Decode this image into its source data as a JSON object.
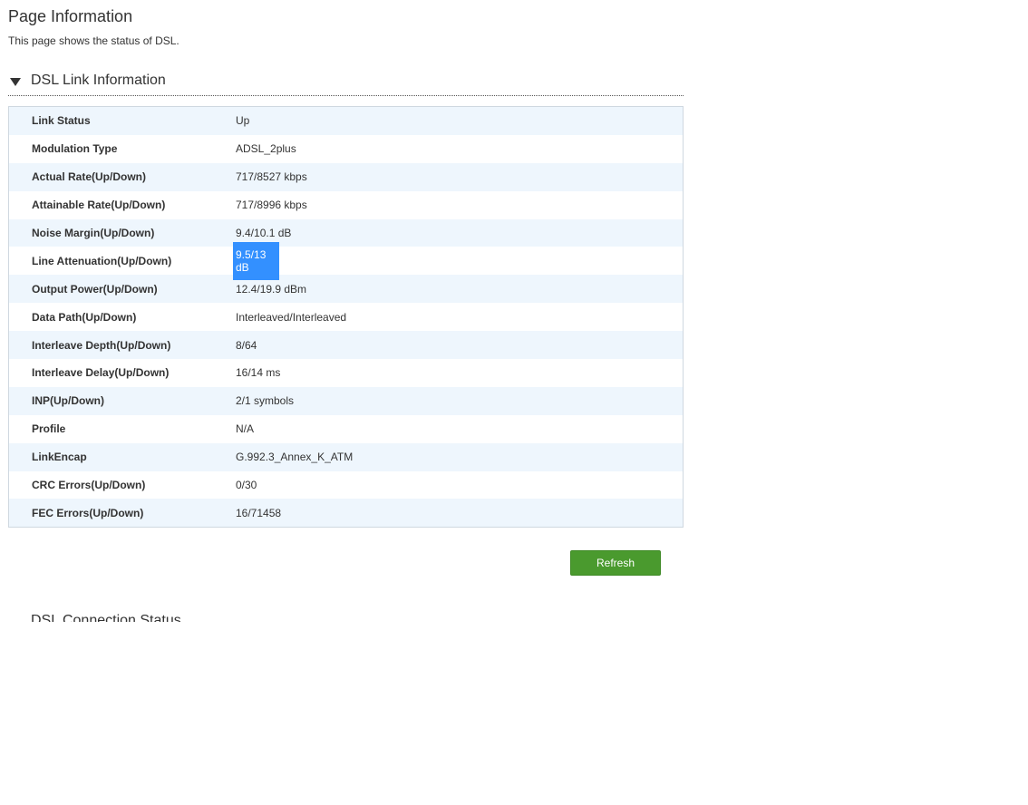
{
  "page": {
    "title": "Page Information",
    "description": "This page shows the status of DSL."
  },
  "section": {
    "title": "DSL Link Information"
  },
  "rows": [
    {
      "label": "Link Status",
      "value": "Up"
    },
    {
      "label": "Modulation Type",
      "value": "ADSL_2plus"
    },
    {
      "label": "Actual Rate(Up/Down)",
      "value": "717/8527 kbps"
    },
    {
      "label": "Attainable Rate(Up/Down)",
      "value": "717/8996 kbps"
    },
    {
      "label": "Noise Margin(Up/Down)",
      "value": "9.4/10.1 dB"
    },
    {
      "label": "Line Attenuation(Up/Down)",
      "value": "9.5/13 dB"
    },
    {
      "label": "Output Power(Up/Down)",
      "value": "12.4/19.9 dBm"
    },
    {
      "label": "Data Path(Up/Down)",
      "value": "Interleaved/Interleaved"
    },
    {
      "label": "Interleave Depth(Up/Down)",
      "value": "8/64"
    },
    {
      "label": "Interleave Delay(Up/Down)",
      "value": "16/14 ms"
    },
    {
      "label": "INP(Up/Down)",
      "value": "2/1 symbols"
    },
    {
      "label": "Profile",
      "value": "N/A"
    },
    {
      "label": "LinkEncap",
      "value": "G.992.3_Annex_K_ATM"
    },
    {
      "label": "CRC Errors(Up/Down)",
      "value": "0/30"
    },
    {
      "label": "FEC Errors(Up/Down)",
      "value": "16/71458"
    }
  ],
  "buttons": {
    "refresh": "Refresh"
  },
  "next_section": {
    "title": "DSL Connection Status"
  },
  "colors": {
    "row_alt": "#eef6fd",
    "button": "#4a9a2e",
    "selection": "#3390ff"
  }
}
